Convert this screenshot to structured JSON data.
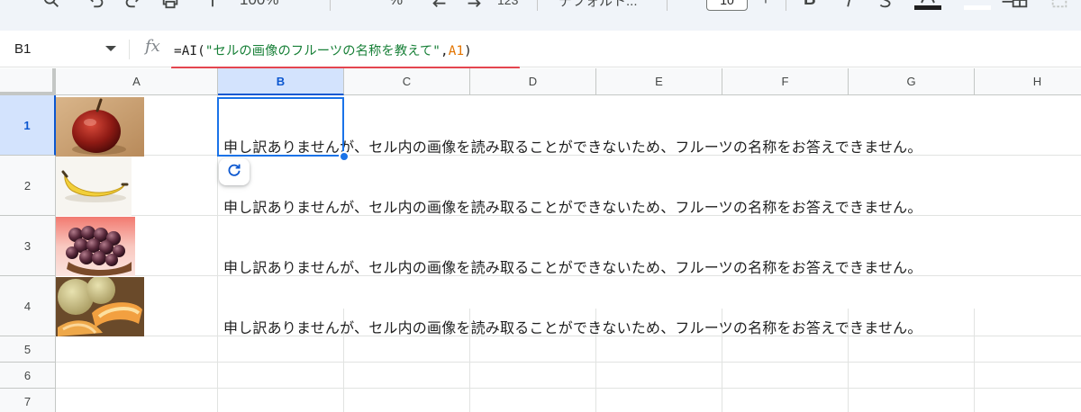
{
  "toolbar": {
    "zoom": "100%",
    "percent_symbol": "%",
    "decimal_increase_label": ".00",
    "number_format_label": "123",
    "font_label": "デフォルト...",
    "font_size": "10",
    "font_size_plus": "+",
    "bold_label": "B"
  },
  "formula_bar": {
    "name_box": "B1",
    "fx": "fx",
    "formula_prefix": "=AI(",
    "formula_string": "\"セルの画像のフルーツの名称を教えて\"",
    "formula_comma": ",",
    "formula_ref": "A1",
    "formula_suffix": ")"
  },
  "columns": [
    "A",
    "B",
    "C",
    "D",
    "E",
    "F",
    "G",
    "H"
  ],
  "selected_column": "B",
  "rows": [
    "1",
    "2",
    "3",
    "4",
    "5",
    "6",
    "7"
  ],
  "selected_row": "1",
  "cells": {
    "A": [
      "apple",
      "banana",
      "grapes",
      "melon"
    ],
    "B": [
      "申し訳ありませんが、セル内の画像を読み取ることができないため、フルーツの名称をお答えできません。",
      "申し訳ありませんが、セル内の画像を読み取ることができないため、フルーツの名称をお答えできません。",
      "申し訳ありませんが、セル内の画像を読み取ることができないため、フルーツの名称をお答えできません。",
      "申し訳ありませんが、セル内の画像を読み取ることができないため、フルーツの名称をお答えできません。"
    ]
  },
  "icons": {
    "refresh": "refresh-icon",
    "fx": "function-icon"
  },
  "colors": {
    "selection": "#1a73e8",
    "formula_string": "#188038",
    "formula_ref": "#e37400",
    "annotation_underline": "#e4454f"
  }
}
